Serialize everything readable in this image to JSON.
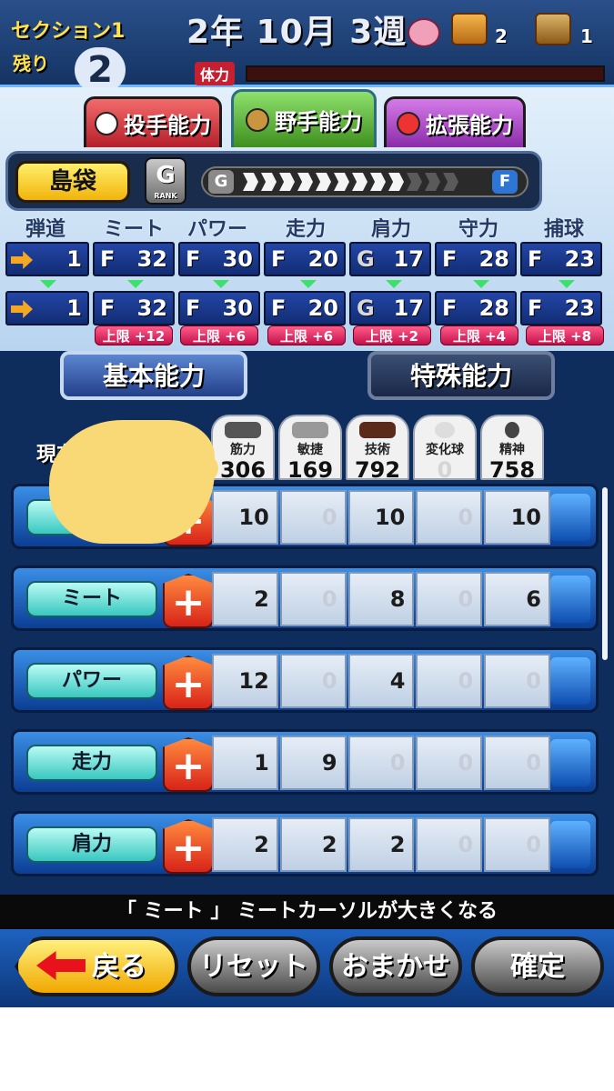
{
  "status": {
    "section_label": "セクション1",
    "remaining_label": "残り",
    "remaining_value": "2",
    "date": "2年 10月 3週",
    "chest_gold_count": "2",
    "chest_silver_count": "1",
    "stamina_label": "体力"
  },
  "tabs": [
    {
      "label": "投手能力"
    },
    {
      "label": "野手能力"
    },
    {
      "label": "拡張能力"
    }
  ],
  "player": {
    "name": "島袋",
    "rank": "G",
    "rank_sub": "RANK",
    "rank_track_start": "G",
    "rank_track_end": "F"
  },
  "stats": {
    "headers": [
      "弾道",
      "ミート",
      "パワー",
      "走力",
      "肩力",
      "守力",
      "捕球"
    ],
    "current": [
      {
        "grade": "",
        "value": "1"
      },
      {
        "grade": "F",
        "value": "32"
      },
      {
        "grade": "F",
        "value": "30"
      },
      {
        "grade": "F",
        "value": "20"
      },
      {
        "grade": "G",
        "value": "17"
      },
      {
        "grade": "F",
        "value": "28"
      },
      {
        "grade": "F",
        "value": "23"
      }
    ],
    "next": [
      {
        "grade": "",
        "value": "1"
      },
      {
        "grade": "F",
        "value": "32"
      },
      {
        "grade": "F",
        "value": "30"
      },
      {
        "grade": "F",
        "value": "20"
      },
      {
        "grade": "G",
        "value": "17"
      },
      {
        "grade": "F",
        "value": "28"
      },
      {
        "grade": "F",
        "value": "23"
      }
    ],
    "limits": [
      "上限 +12",
      "上限 +6",
      "上限 +6",
      "上限 +2",
      "上限 +4",
      "上限 +8"
    ]
  },
  "categories": {
    "basic": "基本能力",
    "special": "特殊能力"
  },
  "exp": {
    "label": "現在の経験点",
    "columns": [
      {
        "name": "筋力",
        "points": "306"
      },
      {
        "name": "敏捷",
        "points": "169"
      },
      {
        "name": "技術",
        "points": "792"
      },
      {
        "name": "変化球",
        "points": "0"
      },
      {
        "name": "精神",
        "points": "758"
      }
    ]
  },
  "attributes": [
    {
      "label": "",
      "costs": [
        "10",
        "0",
        "10",
        "0",
        "10"
      ]
    },
    {
      "label": "ミート",
      "costs": [
        "2",
        "0",
        "8",
        "0",
        "6"
      ]
    },
    {
      "label": "パワー",
      "costs": [
        "12",
        "0",
        "4",
        "0",
        "0"
      ]
    },
    {
      "label": "走力",
      "costs": [
        "1",
        "9",
        "0",
        "0",
        "0"
      ]
    },
    {
      "label": "肩力",
      "costs": [
        "2",
        "2",
        "2",
        "0",
        "0"
      ]
    }
  ],
  "hint": "「 ミート 」 ミートカーソルが大きくなる",
  "footer": {
    "back": "戻る",
    "reset": "リセット",
    "auto": "おまかせ",
    "confirm": "確定"
  }
}
